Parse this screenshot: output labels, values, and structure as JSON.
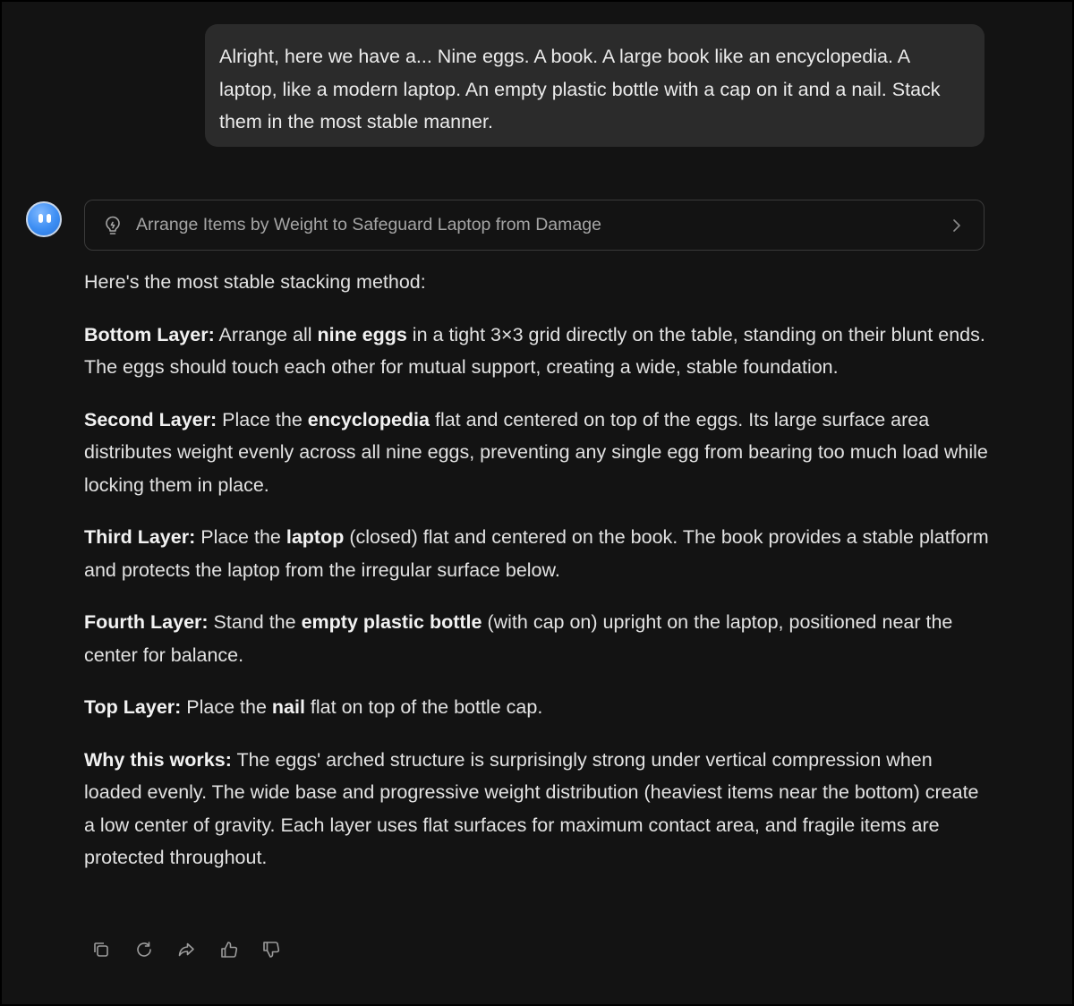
{
  "user_message": {
    "text": "Alright, here we have a... Nine eggs. A book. A large book like an encyclopedia. A laptop, like a modern laptop. An empty plastic bottle with a cap on it and a nail. Stack them in the most stable manner."
  },
  "assistant": {
    "avatar_icon": "smiley-face-icon",
    "thinking": {
      "icon": "lightbulb-icon",
      "label": "Arrange Items by Weight to Safeguard Laptop from Damage",
      "chevron_icon": "chevron-right-icon"
    },
    "intro": "Here's the most stable stacking method:",
    "layers": {
      "bottom": {
        "heading": "Bottom Layer:",
        "t1": " Arrange all ",
        "b1": "nine eggs",
        "t2": " in a tight 3×3 grid directly on the table, standing on their blunt ends. The eggs should touch each other for mutual support, creating a wide, stable foundation."
      },
      "second": {
        "heading": "Second Layer:",
        "t1": " Place the ",
        "b1": "encyclopedia",
        "t2": " flat and centered on top of the eggs. Its large surface area distributes weight evenly across all nine eggs, preventing any single egg from bearing too much load while locking them in place."
      },
      "third": {
        "heading": "Third Layer:",
        "t1": " Place the ",
        "b1": "laptop",
        "t2": " (closed) flat and centered on the book. The book provides a stable platform and protects the laptop from the irregular surface below."
      },
      "fourth": {
        "heading": "Fourth Layer:",
        "t1": " Stand the ",
        "b1": "empty plastic bottle",
        "t2": " (with cap on) upright on the laptop, positioned near the center for balance."
      },
      "top": {
        "heading": "Top Layer:",
        "t1": " Place the ",
        "b1": "nail",
        "t2": " flat on top of the bottle cap."
      }
    },
    "why": {
      "heading": "Why this works:",
      "text": " The eggs' arched structure is surprisingly strong under vertical compression when loaded evenly. The wide base and progressive weight distribution (heaviest items near the bottom) create a low center of gravity. Each layer uses flat surfaces for maximum contact area, and fragile items are protected throughout."
    },
    "actions": [
      "copy-icon",
      "regenerate-icon",
      "share-icon",
      "thumbs-up-icon",
      "thumbs-down-icon"
    ]
  },
  "colors": {
    "background": "#131313",
    "user_bubble": "#2b2b2b",
    "text": "#e2e2e2",
    "muted": "#a5a5a5",
    "avatar_blue": "#3d8ef3"
  }
}
